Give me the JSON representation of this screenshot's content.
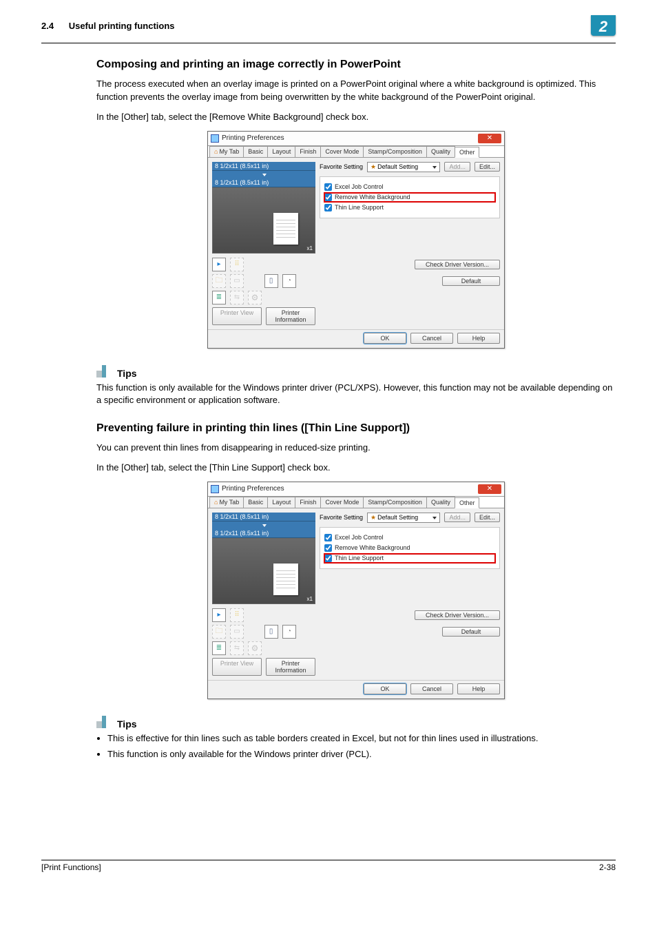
{
  "header": {
    "section_num": "2.4",
    "section_title": "Useful printing functions",
    "chapter_badge": "2"
  },
  "section1": {
    "title": "Composing and printing an image correctly in PowerPoint",
    "para1": "The process executed when an overlay image is printed on a PowerPoint original where a white background is optimized. This function prevents the overlay image from being overwritten by the white background of the PowerPoint original.",
    "para2": "In the [Other] tab, select the [Remove White Background] check box."
  },
  "tips1": {
    "label": "Tips",
    "text": "This function is only available for the Windows printer driver (PCL/XPS). However, this function may not be available depending on a specific environment or application software."
  },
  "section2": {
    "title": "Preventing failure in printing thin lines ([Thin Line Support])",
    "para1": "You can prevent thin lines from disappearing in reduced-size printing.",
    "para2": "In the [Other] tab, select the [Thin Line Support] check box."
  },
  "tips2": {
    "label": "Tips",
    "bullets": [
      "This is effective for thin lines such as table borders created in Excel, but not for thin lines used in illustrations.",
      "This function is only available for the Windows printer driver (PCL)."
    ]
  },
  "dialog": {
    "title": "Printing Preferences",
    "tabs": {
      "mytab": "My Tab",
      "basic": "Basic",
      "layout": "Layout",
      "finish": "Finish",
      "cover": "Cover Mode",
      "stamp": "Stamp/Composition",
      "quality": "Quality",
      "other": "Other"
    },
    "size_top": "8 1/2x11 (8.5x11 in)",
    "size_bot": "8 1/2x11 (8.5x11 in)",
    "xn": "x1",
    "printer_view": "Printer View",
    "printer_info": "Printer Information",
    "fav_label": "Favorite Setting",
    "fav_value": "Default Setting",
    "add_btn": "Add...",
    "edit_btn": "Edit...",
    "chk_excel": "Excel Job Control",
    "chk_white": "Remove White Background",
    "chk_thin": "Thin Line Support",
    "chk_version": "Check Driver Version...",
    "default_btn": "Default",
    "ok": "OK",
    "cancel": "Cancel",
    "help": "Help"
  },
  "footer": {
    "left": "[Print Functions]",
    "right": "2-38"
  }
}
